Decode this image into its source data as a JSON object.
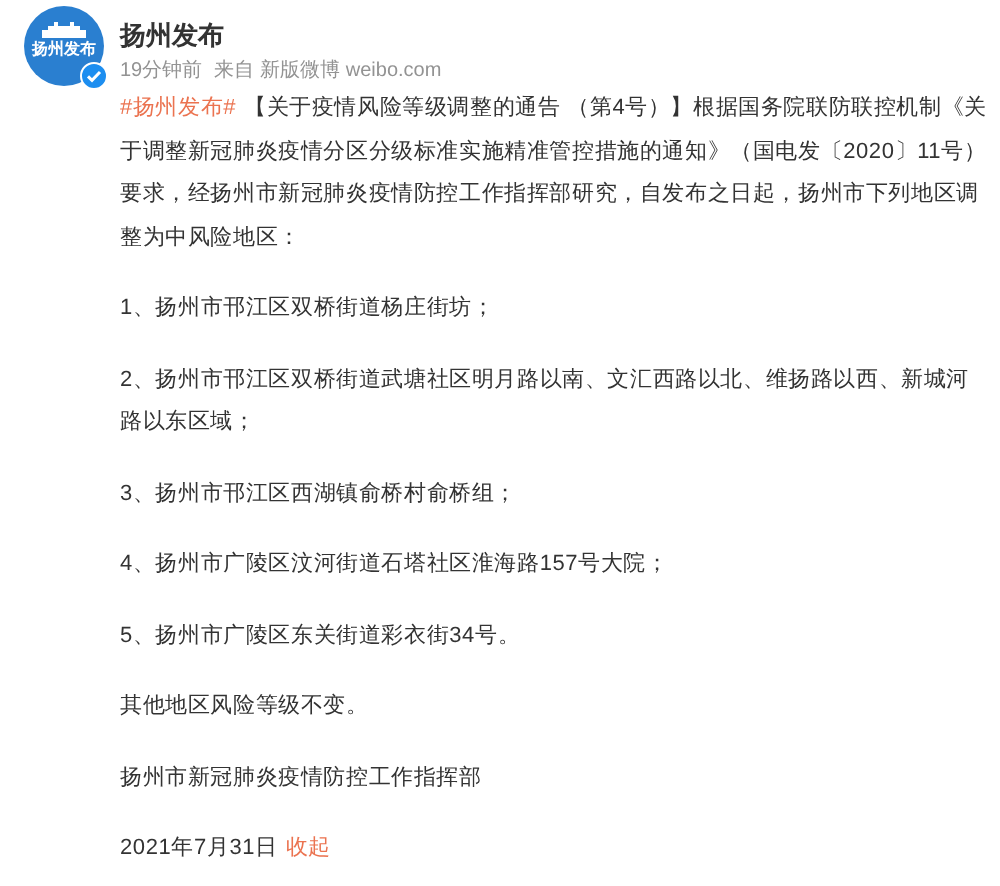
{
  "account": {
    "avatar_text": "扬州发布",
    "name": "扬州发布",
    "verified": true
  },
  "meta": {
    "time": "19分钟前",
    "source_label": "来自",
    "client": "新版微博 weibo.com"
  },
  "post": {
    "hashtag": "#扬州发布#",
    "paragraphs": [
      "【关于疫情风险等级调整的通告 （第4号）】根据国务院联防联控机制《关于调整新冠肺炎疫情分区分级标准实施精准管控措施的通知》（国电发〔2020〕11号）要求，经扬州市新冠肺炎疫情防控工作指挥部研究，自发布之日起，扬州市下列地区调整为中风险地区：",
      "1、扬州市邗江区双桥街道杨庄街坊；",
      "2、扬州市邗江区双桥街道武塘社区明月路以南、文汇西路以北、维扬路以西、新城河路以东区域；",
      "3、扬州市邗江区西湖镇俞桥村俞桥组；",
      "4、扬州市广陵区汶河街道石塔社区淮海路157号大院；",
      "5、扬州市广陵区东关街道彩衣街34号。",
      "其他地区风险等级不变。",
      "扬州市新冠肺炎疫情防控工作指挥部"
    ],
    "date": "2021年7月31日",
    "collapse_link": "收起"
  }
}
